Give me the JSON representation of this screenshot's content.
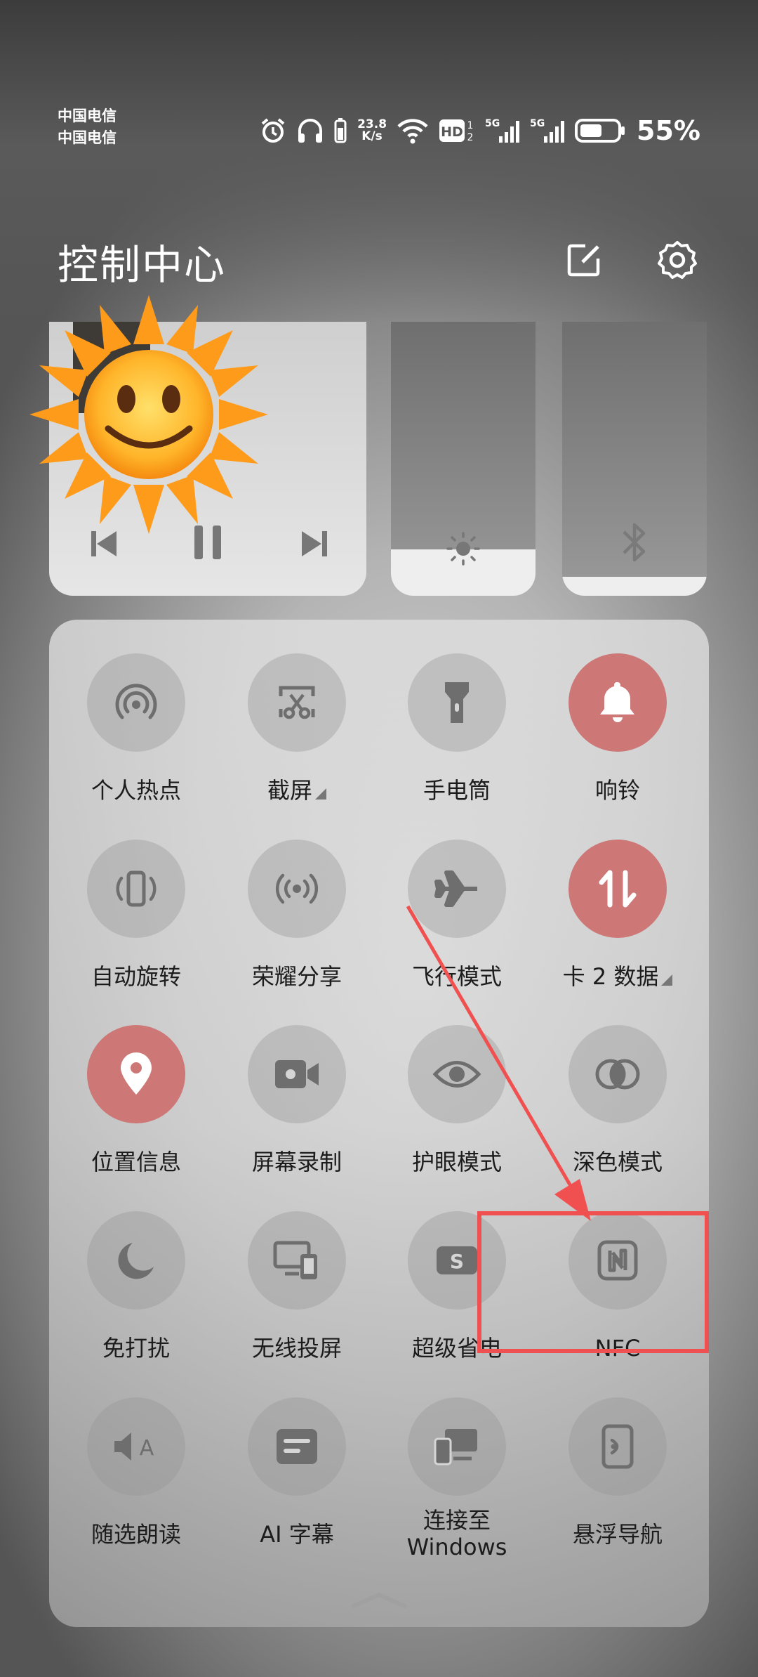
{
  "status_bar": {
    "carrier_1": "中国电信",
    "carrier_2": "中国电信",
    "net_speed_value": "23.8",
    "net_speed_unit": "K/s",
    "battery_pct": "55%",
    "icons": [
      "alarm-icon",
      "headphones-icon",
      "headset-battery-icon",
      "wifi-icon",
      "hd-volte-icon",
      "signal-5g-icon",
      "signal-5g-icon",
      "battery-icon"
    ]
  },
  "header": {
    "title": "控制中心",
    "edit_icon": "edit-icon",
    "settings_icon": "settings-gear-icon"
  },
  "media": {
    "prev_icon": "previous-track-icon",
    "pause_icon": "pause-icon",
    "next_icon": "next-track-icon",
    "sticker": "sun-face-sticker"
  },
  "sliders": {
    "brightness": {
      "icon": "brightness-icon",
      "level": 0.17
    },
    "volume": {
      "icon": "bluetooth-icon",
      "level": 0.07
    }
  },
  "tiles": [
    {
      "label": "个人热点",
      "icon": "hotspot-icon",
      "on": false
    },
    {
      "label": "截屏",
      "icon": "screenshot-scissors-icon",
      "on": false,
      "more": true
    },
    {
      "label": "手电筒",
      "icon": "flashlight-icon",
      "on": false
    },
    {
      "label": "响铃",
      "icon": "bell-icon",
      "on": true
    },
    {
      "label": "自动旋转",
      "icon": "auto-rotate-icon",
      "on": false
    },
    {
      "label": "荣耀分享",
      "icon": "honor-share-icon",
      "on": false
    },
    {
      "label": "飞行模式",
      "icon": "airplane-icon",
      "on": false
    },
    {
      "label": "卡 2 数据",
      "icon": "mobile-data-icon",
      "on": true,
      "more": true
    },
    {
      "label": "位置信息",
      "icon": "location-icon",
      "on": true
    },
    {
      "label": "屏幕录制",
      "icon": "screen-record-icon",
      "on": false
    },
    {
      "label": "护眼模式",
      "icon": "eye-comfort-icon",
      "on": false
    },
    {
      "label": "深色模式",
      "icon": "dark-mode-icon",
      "on": false
    },
    {
      "label": "免打扰",
      "icon": "do-not-disturb-icon",
      "on": false
    },
    {
      "label": "无线投屏",
      "icon": "wireless-projection-icon",
      "on": false
    },
    {
      "label": "超级省电",
      "icon": "power-saving-icon",
      "on": false
    },
    {
      "label": "NFC",
      "icon": "nfc-icon",
      "on": false
    },
    {
      "label": "随选朗读",
      "icon": "read-aloud-icon",
      "on": false
    },
    {
      "label": "AI 字幕",
      "icon": "ai-subtitle-icon",
      "on": false
    },
    {
      "label": "连接至\nWindows",
      "icon": "connect-windows-icon",
      "on": false
    },
    {
      "label": "悬浮导航",
      "icon": "floating-nav-icon",
      "on": false
    }
  ],
  "panel_handle_icon": "collapse-chevron-icon",
  "annotation": {
    "color": "#f05050"
  },
  "colors": {
    "tile_on": "#cd7777",
    "tile_off": "rgba(150,150,150,0.38)"
  }
}
